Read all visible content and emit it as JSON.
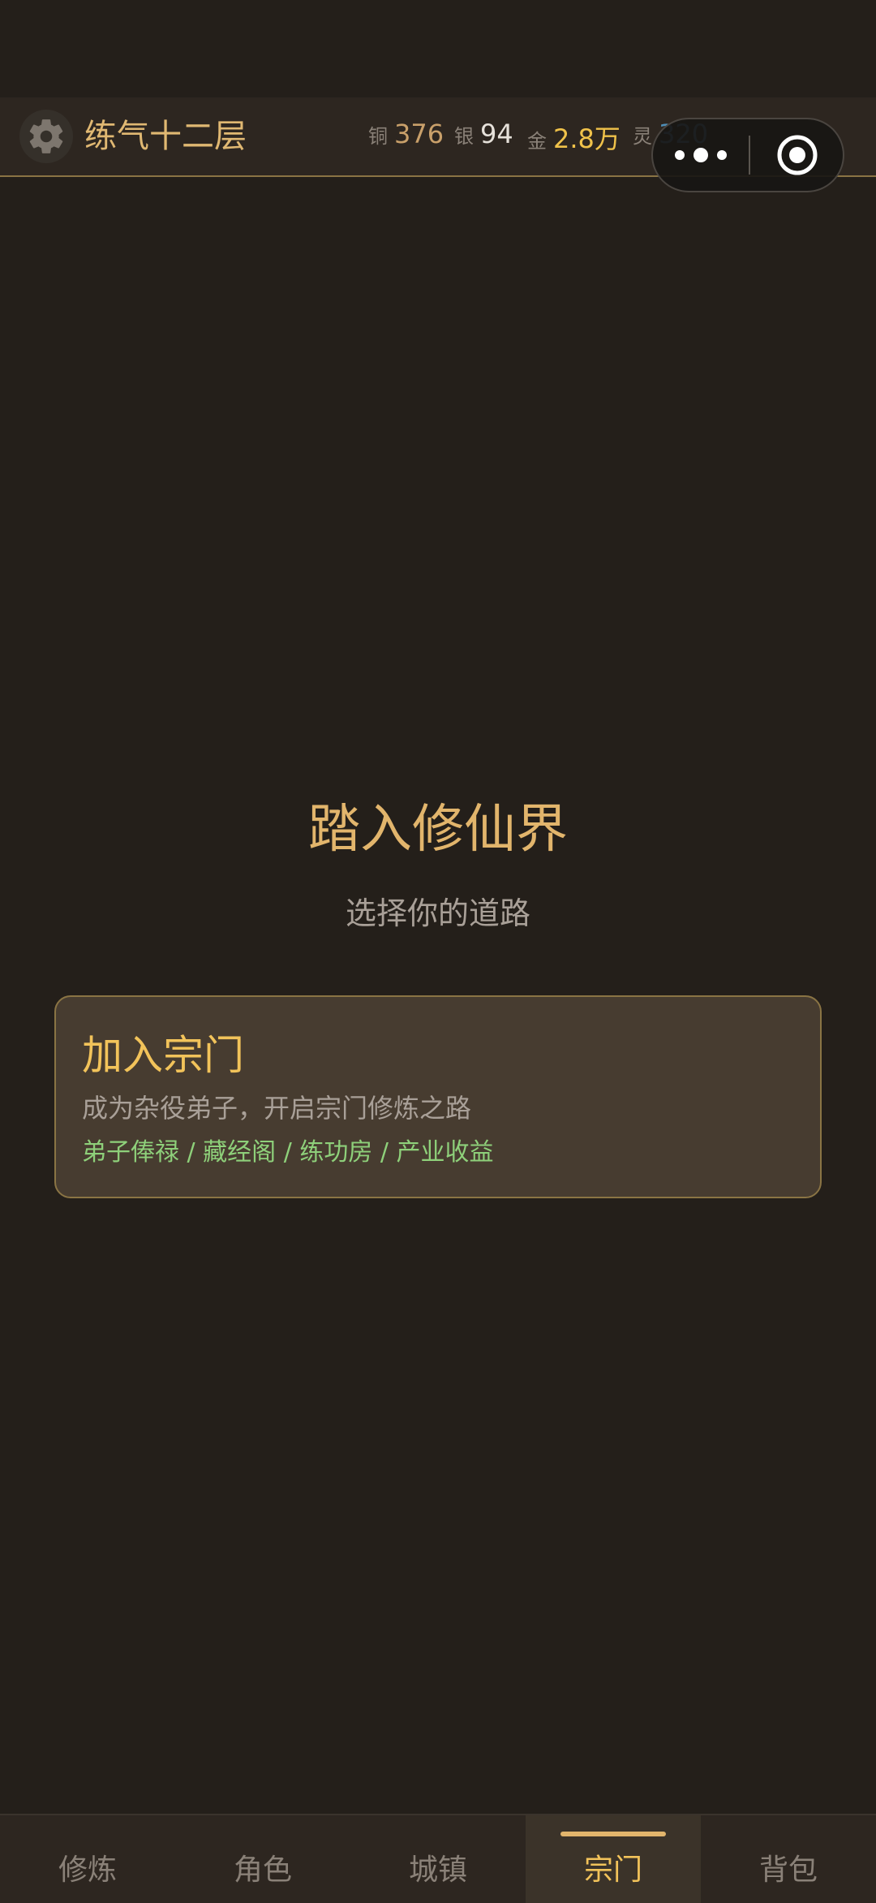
{
  "header": {
    "realm": "练气十二层",
    "currencies": {
      "copper": {
        "label": "铜",
        "value": "376"
      },
      "silver": {
        "label": "银",
        "value": "94"
      },
      "gold": {
        "label": "金",
        "value": "2.8万"
      },
      "spirit": {
        "label": "灵",
        "value": "320"
      }
    }
  },
  "main": {
    "title": "踏入修仙界",
    "subtitle": "选择你的道路",
    "card": {
      "title": "加入宗门",
      "description": "成为杂役弟子，开启宗门修炼之路",
      "perks": "弟子俸禄 / 藏经阁 / 练功房 / 产业收益"
    }
  },
  "tabs": [
    {
      "label": "修炼",
      "active": false
    },
    {
      "label": "角色",
      "active": false
    },
    {
      "label": "城镇",
      "active": false
    },
    {
      "label": "宗门",
      "active": true
    },
    {
      "label": "背包",
      "active": false
    }
  ],
  "colors": {
    "background": "#241f1a",
    "header_bg": "#2d2620",
    "accent_gold": "#e2b56c",
    "card_bg": "#473c30",
    "perk_green": "#8ed07a",
    "spirit_blue": "#4f8fb8"
  },
  "icons": {
    "settings": "gear-icon",
    "capsule_more": "more-dots-icon",
    "capsule_close": "target-close-icon"
  }
}
